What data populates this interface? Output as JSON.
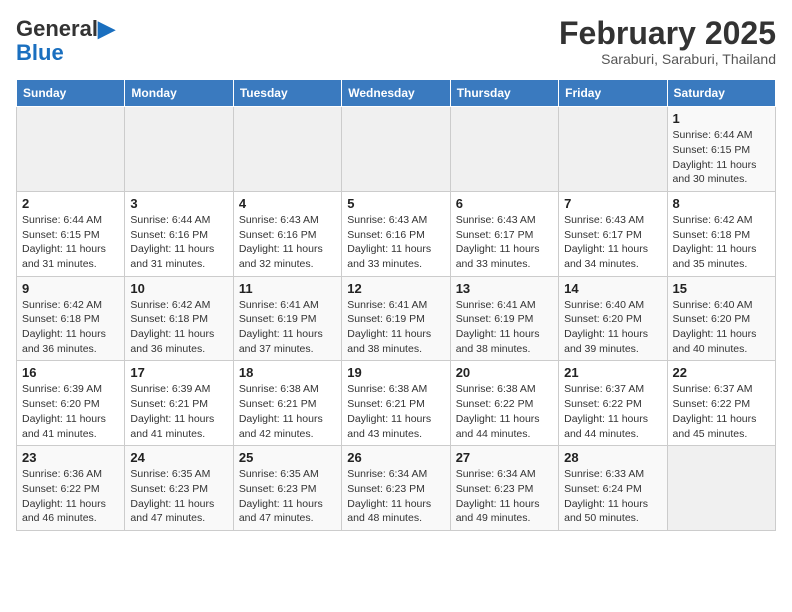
{
  "header": {
    "logo_line1": "General",
    "logo_line2": "Blue",
    "month": "February 2025",
    "location": "Saraburi, Saraburi, Thailand"
  },
  "days_of_week": [
    "Sunday",
    "Monday",
    "Tuesday",
    "Wednesday",
    "Thursday",
    "Friday",
    "Saturday"
  ],
  "weeks": [
    [
      {
        "day": "",
        "info": ""
      },
      {
        "day": "",
        "info": ""
      },
      {
        "day": "",
        "info": ""
      },
      {
        "day": "",
        "info": ""
      },
      {
        "day": "",
        "info": ""
      },
      {
        "day": "",
        "info": ""
      },
      {
        "day": "1",
        "info": "Sunrise: 6:44 AM\nSunset: 6:15 PM\nDaylight: 11 hours\nand 30 minutes."
      }
    ],
    [
      {
        "day": "2",
        "info": "Sunrise: 6:44 AM\nSunset: 6:15 PM\nDaylight: 11 hours\nand 31 minutes."
      },
      {
        "day": "3",
        "info": "Sunrise: 6:44 AM\nSunset: 6:16 PM\nDaylight: 11 hours\nand 31 minutes."
      },
      {
        "day": "4",
        "info": "Sunrise: 6:43 AM\nSunset: 6:16 PM\nDaylight: 11 hours\nand 32 minutes."
      },
      {
        "day": "5",
        "info": "Sunrise: 6:43 AM\nSunset: 6:16 PM\nDaylight: 11 hours\nand 33 minutes."
      },
      {
        "day": "6",
        "info": "Sunrise: 6:43 AM\nSunset: 6:17 PM\nDaylight: 11 hours\nand 33 minutes."
      },
      {
        "day": "7",
        "info": "Sunrise: 6:43 AM\nSunset: 6:17 PM\nDaylight: 11 hours\nand 34 minutes."
      },
      {
        "day": "8",
        "info": "Sunrise: 6:42 AM\nSunset: 6:18 PM\nDaylight: 11 hours\nand 35 minutes."
      }
    ],
    [
      {
        "day": "9",
        "info": "Sunrise: 6:42 AM\nSunset: 6:18 PM\nDaylight: 11 hours\nand 36 minutes."
      },
      {
        "day": "10",
        "info": "Sunrise: 6:42 AM\nSunset: 6:18 PM\nDaylight: 11 hours\nand 36 minutes."
      },
      {
        "day": "11",
        "info": "Sunrise: 6:41 AM\nSunset: 6:19 PM\nDaylight: 11 hours\nand 37 minutes."
      },
      {
        "day": "12",
        "info": "Sunrise: 6:41 AM\nSunset: 6:19 PM\nDaylight: 11 hours\nand 38 minutes."
      },
      {
        "day": "13",
        "info": "Sunrise: 6:41 AM\nSunset: 6:19 PM\nDaylight: 11 hours\nand 38 minutes."
      },
      {
        "day": "14",
        "info": "Sunrise: 6:40 AM\nSunset: 6:20 PM\nDaylight: 11 hours\nand 39 minutes."
      },
      {
        "day": "15",
        "info": "Sunrise: 6:40 AM\nSunset: 6:20 PM\nDaylight: 11 hours\nand 40 minutes."
      }
    ],
    [
      {
        "day": "16",
        "info": "Sunrise: 6:39 AM\nSunset: 6:20 PM\nDaylight: 11 hours\nand 41 minutes."
      },
      {
        "day": "17",
        "info": "Sunrise: 6:39 AM\nSunset: 6:21 PM\nDaylight: 11 hours\nand 41 minutes."
      },
      {
        "day": "18",
        "info": "Sunrise: 6:38 AM\nSunset: 6:21 PM\nDaylight: 11 hours\nand 42 minutes."
      },
      {
        "day": "19",
        "info": "Sunrise: 6:38 AM\nSunset: 6:21 PM\nDaylight: 11 hours\nand 43 minutes."
      },
      {
        "day": "20",
        "info": "Sunrise: 6:38 AM\nSunset: 6:22 PM\nDaylight: 11 hours\nand 44 minutes."
      },
      {
        "day": "21",
        "info": "Sunrise: 6:37 AM\nSunset: 6:22 PM\nDaylight: 11 hours\nand 44 minutes."
      },
      {
        "day": "22",
        "info": "Sunrise: 6:37 AM\nSunset: 6:22 PM\nDaylight: 11 hours\nand 45 minutes."
      }
    ],
    [
      {
        "day": "23",
        "info": "Sunrise: 6:36 AM\nSunset: 6:22 PM\nDaylight: 11 hours\nand 46 minutes."
      },
      {
        "day": "24",
        "info": "Sunrise: 6:35 AM\nSunset: 6:23 PM\nDaylight: 11 hours\nand 47 minutes."
      },
      {
        "day": "25",
        "info": "Sunrise: 6:35 AM\nSunset: 6:23 PM\nDaylight: 11 hours\nand 47 minutes."
      },
      {
        "day": "26",
        "info": "Sunrise: 6:34 AM\nSunset: 6:23 PM\nDaylight: 11 hours\nand 48 minutes."
      },
      {
        "day": "27",
        "info": "Sunrise: 6:34 AM\nSunset: 6:23 PM\nDaylight: 11 hours\nand 49 minutes."
      },
      {
        "day": "28",
        "info": "Sunrise: 6:33 AM\nSunset: 6:24 PM\nDaylight: 11 hours\nand 50 minutes."
      },
      {
        "day": "",
        "info": ""
      }
    ]
  ]
}
